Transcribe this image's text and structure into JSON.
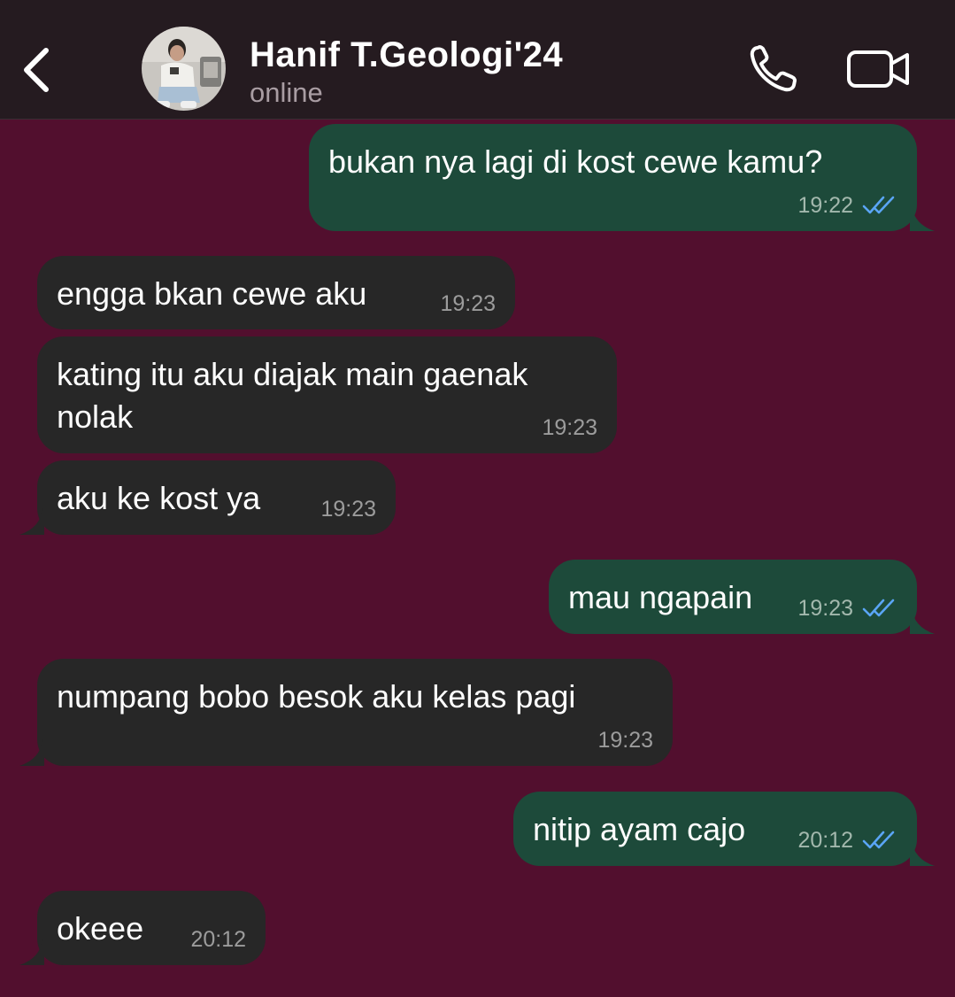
{
  "header": {
    "contact_name": "Hanif T.Geologi'24",
    "status": "online",
    "back_icon": "chevron-left-icon",
    "call_icon": "phone-icon",
    "video_icon": "video-camera-icon"
  },
  "colors": {
    "chat_background": "#520f2e",
    "header_background": "#251b20",
    "outgoing_bubble": "#1d4a3a",
    "incoming_bubble": "#272727",
    "read_check": "#5aa5f5"
  },
  "messages": [
    {
      "direction": "out",
      "lines": [
        "bukan nya lagi di kost cewe kamu?"
      ],
      "time": "19:22",
      "read": true
    },
    {
      "direction": "in",
      "lines": [
        "engga bkan cewe aku"
      ],
      "time": "19:23"
    },
    {
      "direction": "in",
      "lines": [
        "kating itu aku diajak main gaenak",
        "nolak"
      ],
      "time": "19:23"
    },
    {
      "direction": "in",
      "lines": [
        "aku ke kost ya"
      ],
      "time": "19:23"
    },
    {
      "direction": "out",
      "lines": [
        "mau ngapain"
      ],
      "time": "19:23",
      "read": true
    },
    {
      "direction": "in",
      "lines": [
        "numpang bobo besok aku kelas pagi"
      ],
      "time": "19:23"
    },
    {
      "direction": "out",
      "lines": [
        "nitip ayam cajo"
      ],
      "time": "20:12",
      "read": true
    },
    {
      "direction": "in",
      "lines": [
        "okeee"
      ],
      "time": "20:12"
    }
  ]
}
